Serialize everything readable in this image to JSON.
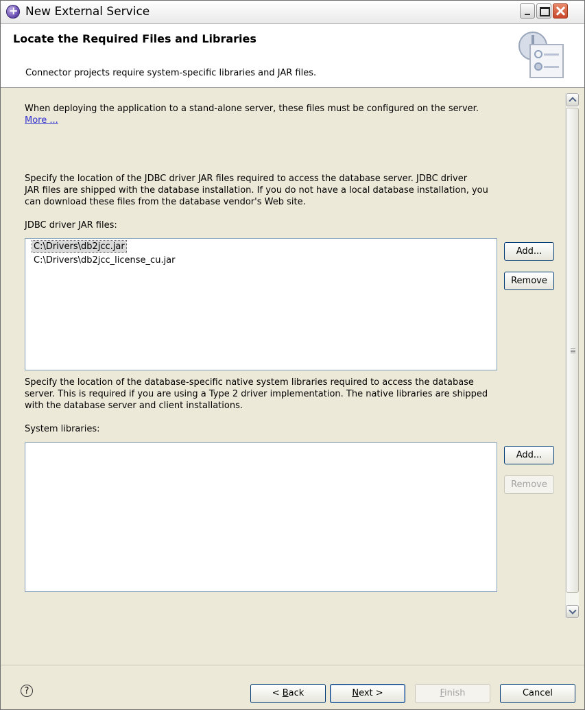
{
  "window": {
    "title": "New External Service"
  },
  "banner": {
    "title": "Locate the Required Files and Libraries",
    "description": "Connector projects require system-specific libraries and JAR files."
  },
  "content": {
    "intro_line": "When deploying the application to a stand-alone server, these files must be configured on the server.",
    "more_link": "More ...",
    "jdbc_desc_line1": "Specify the location of the JDBC driver JAR files required to access the database server. JDBC driver",
    "jdbc_desc_line2": "JAR files are shipped with the database installation. If you do not have a local database installation, you",
    "jdbc_desc_line3": "can download these files from the database vendor's Web site.",
    "jdbc_label": "JDBC driver JAR files:",
    "jdbc_files": [
      "C:\\Drivers\\db2jcc.jar",
      "C:\\Drivers\\db2jcc_license_cu.jar"
    ],
    "jdbc_selected_index": 0,
    "jdbc_add": "Add...",
    "jdbc_remove": "Remove",
    "native_desc_line1": "Specify the location of the database-specific native system libraries required to access the database",
    "native_desc_line2": "server. This is required if you are using a Type 2 driver implementation. The native libraries are shipped",
    "native_desc_line3": "with the database server and client installations.",
    "system_label": "System libraries:",
    "system_add": "Add...",
    "system_remove": "Remove"
  },
  "footer": {
    "help": "?",
    "back_lt": "< ",
    "back_mnemonic": "B",
    "back_rest": "ack",
    "next_mnemonic": "N",
    "next_rest": "ext >",
    "finish_mnemonic": "F",
    "finish_rest": "inish",
    "cancel": "Cancel"
  },
  "icons": {
    "window": "wizard-globe-icon",
    "banner": "settings-dialog-icon",
    "help": "help-icon"
  }
}
